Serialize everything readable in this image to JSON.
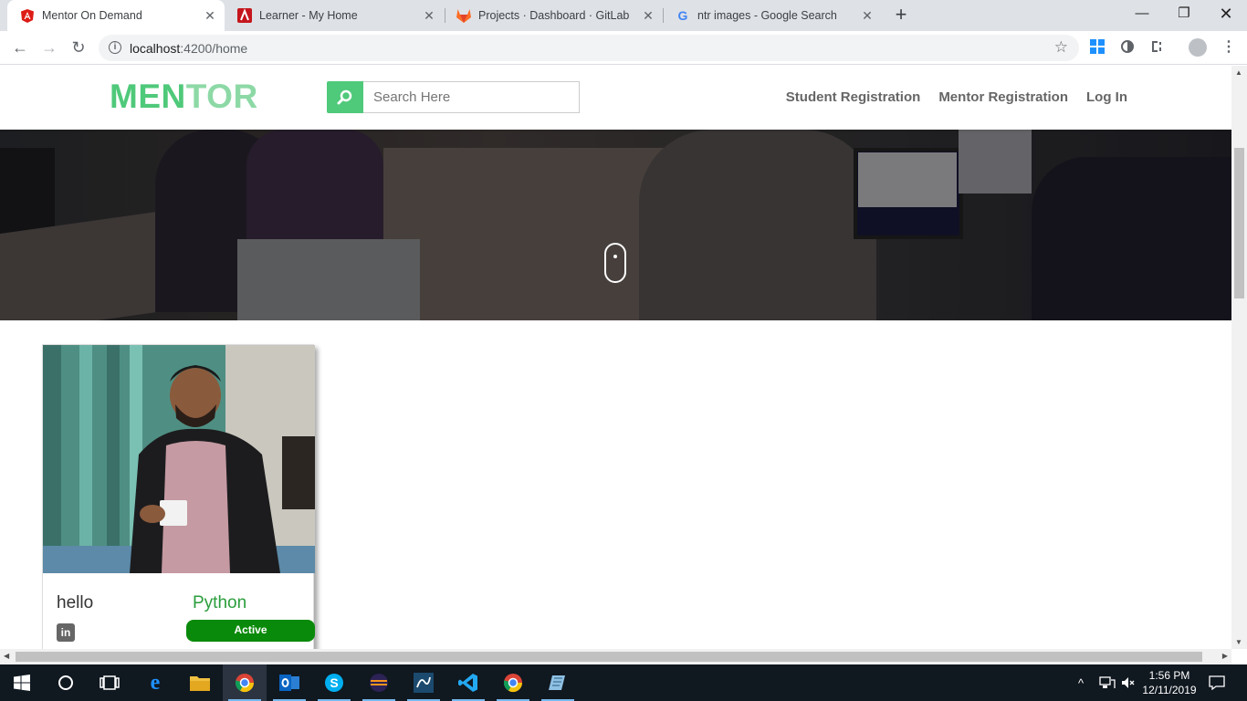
{
  "browser": {
    "tabs": [
      {
        "title": "Mentor On Demand",
        "icon": "angular-icon",
        "active": true
      },
      {
        "title": "Learner - My Home",
        "icon": "acrobat-icon",
        "active": false
      },
      {
        "title": "Projects · Dashboard · GitLab",
        "icon": "gitlab-icon",
        "active": false
      },
      {
        "title": "ntr images - Google Search",
        "icon": "google-icon",
        "active": false
      }
    ],
    "new_tab": "+",
    "url_host": "localhost",
    "url_path": ":4200/home"
  },
  "page": {
    "brand_part1": "MEN",
    "brand_part2": "TOR",
    "brand_color1": "#4fc97a",
    "brand_color2": "#8dd9a6",
    "search_placeholder": "Search Here",
    "nav": {
      "student_registration": "Student Registration",
      "mentor_registration": "Mentor Registration",
      "login": "Log In"
    },
    "card": {
      "name": "hello",
      "skill": "Python",
      "status": "Active",
      "linkedin_label": "in"
    }
  },
  "taskbar": {
    "apps": [
      "windows-start-icon",
      "cortana-icon",
      "task-view-icon",
      "edge-icon",
      "file-explorer-icon",
      "chrome-icon",
      "outlook-icon",
      "skype-icon",
      "eclipse-icon",
      "mysql-workbench-icon",
      "vscode-icon",
      "chrome-icon",
      "notepad-icon"
    ],
    "time": "1:56 PM",
    "date": "12/11/2019"
  }
}
